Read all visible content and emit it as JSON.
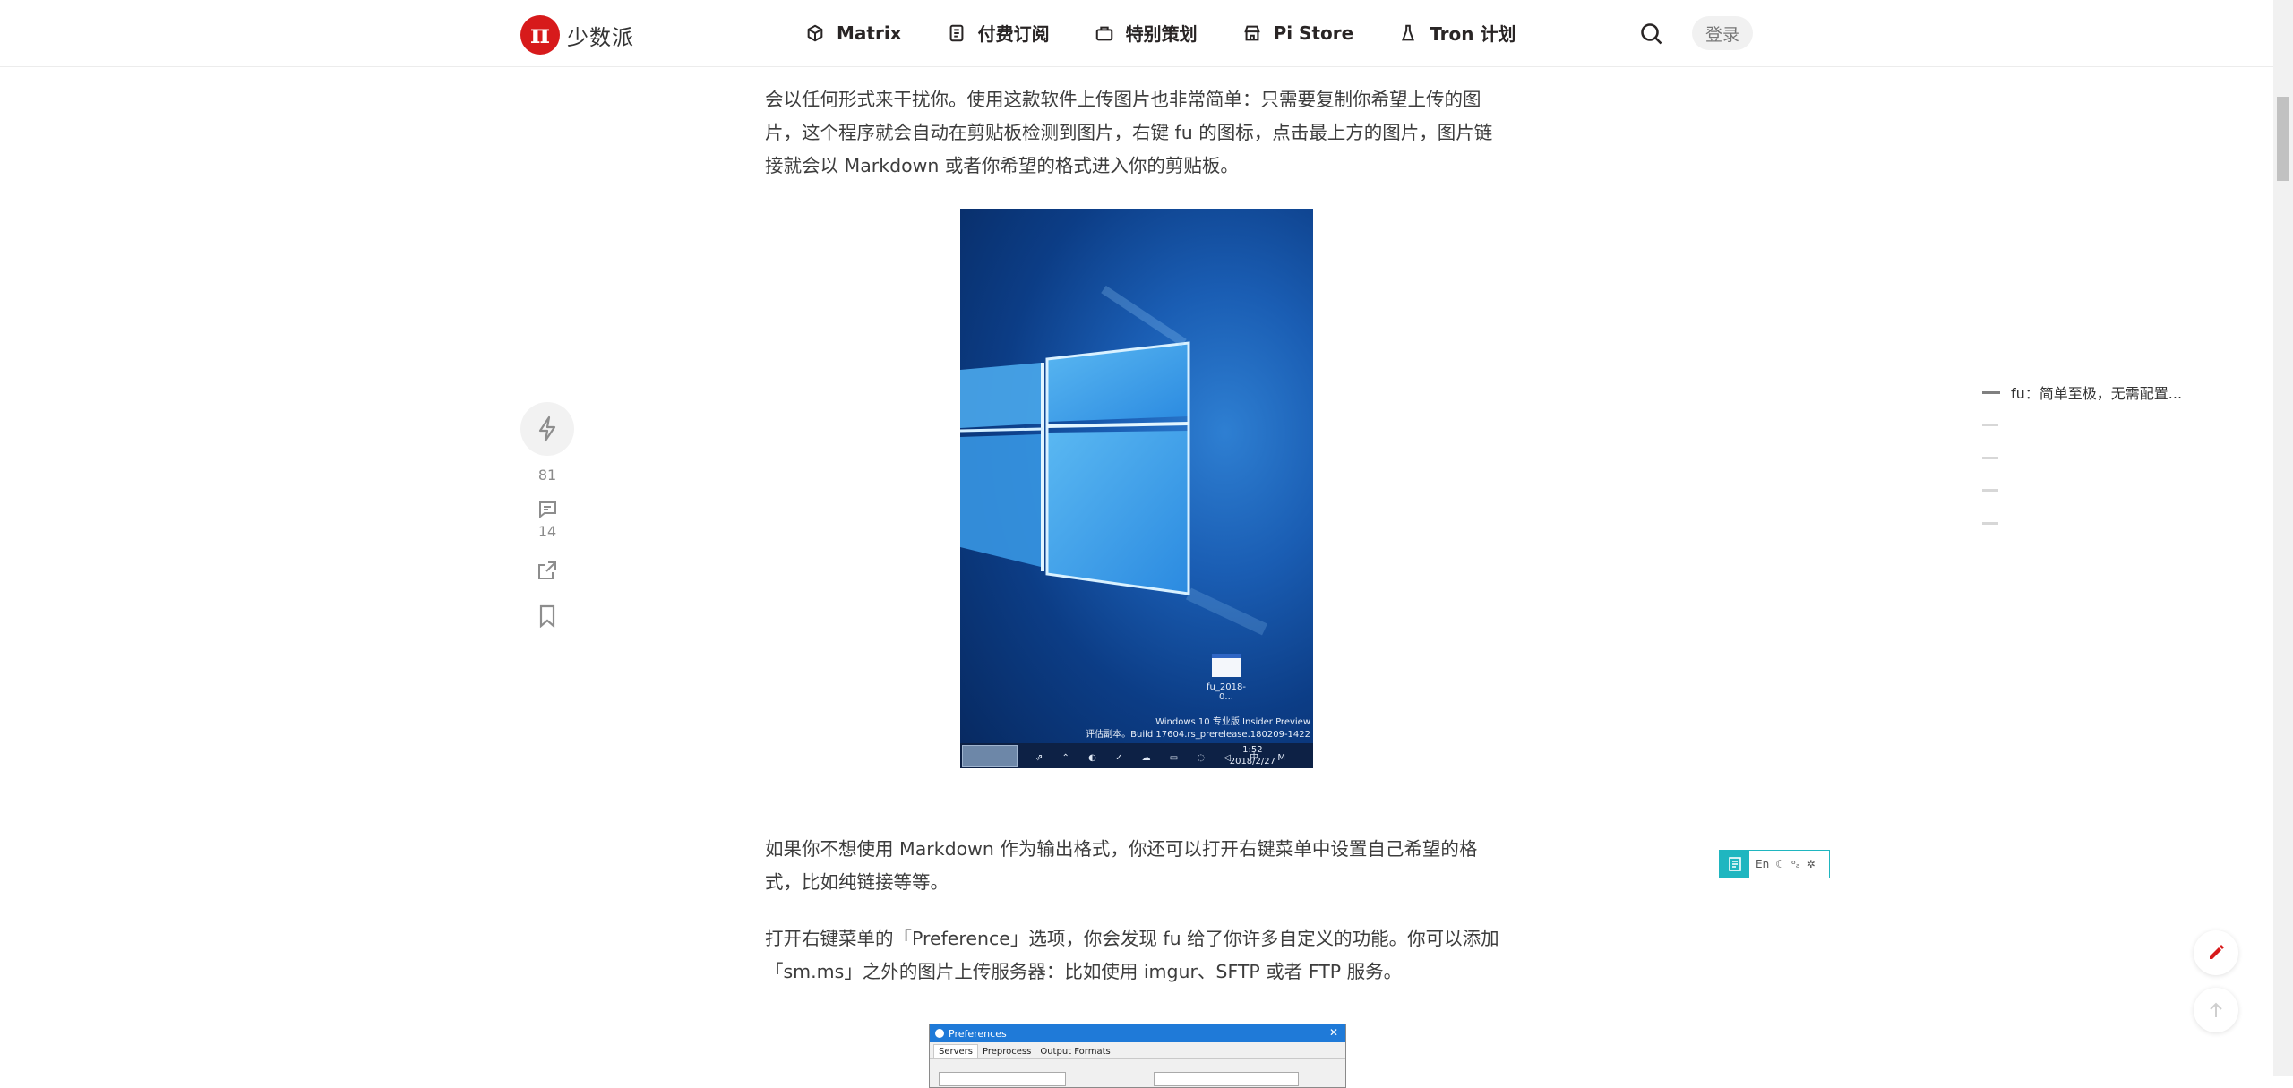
{
  "header": {
    "logo_text": "少数派",
    "nav": [
      {
        "label": "Matrix",
        "icon": "matrix-icon"
      },
      {
        "label": "付费订阅",
        "icon": "subscription-icon"
      },
      {
        "label": "特别策划",
        "icon": "special-icon"
      },
      {
        "label": "Pi Store",
        "icon": "store-icon"
      },
      {
        "label": "Tron 计划",
        "icon": "flask-icon"
      }
    ],
    "login_label": "登录"
  },
  "article": {
    "paragraph_1": "会以任何形式来干扰你。使用这款软件上传图片也非常简单：只需要复制你希望上传的图片，这个程序就会自动在剪贴板检测到图片，右键 fu 的图标，点击最上方的图片，图片链接就会以 Markdown 或者你希望的格式进入你的剪贴板。",
    "paragraph_2": "如果你不想使用 Markdown 作为输出格式，你还可以打开右键菜单中设置自己希望的格式，比如纯链接等等。",
    "paragraph_3": "打开右键菜单的「Preference」选项，你会发现 fu 给了你许多自定义的功能。你可以添加「sm.ms」之外的图片上传服务器：比如使用 imgur、SFTP 或者 FTP 服务。"
  },
  "screenshot_1": {
    "file_label": "fu_2018-0...",
    "watermark_line1": "Windows 10 专业版 Insider Preview",
    "watermark_line2": "评估副本。Build 17604.rs_prerelease.180209-1422",
    "clock_time": "1:52",
    "clock_date": "2018/2/27"
  },
  "screenshot_2": {
    "title": "Preferences",
    "tabs": [
      "Servers",
      "Preprocess",
      "Output Formats"
    ]
  },
  "rail": {
    "like_count": "81",
    "comment_count": "14"
  },
  "toc": {
    "items": [
      "fu：简单至极，无需配置...",
      "",
      "",
      "",
      ""
    ]
  },
  "reading_bar": {
    "language_label": "En"
  },
  "colors": {
    "brand": "#d71a1b",
    "accent": "#1fb6c0"
  }
}
